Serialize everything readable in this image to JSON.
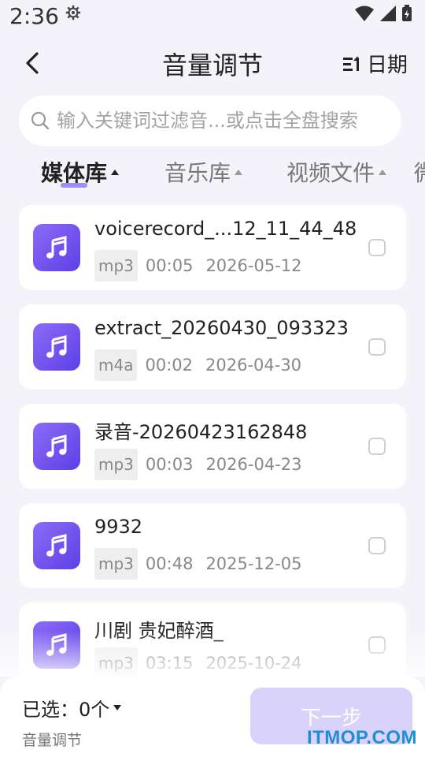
{
  "status_bar": {
    "time": "2:36",
    "icons": [
      "gear-icon",
      "wifi-icon",
      "signal-icon",
      "battery-charging-icon"
    ]
  },
  "header": {
    "title": "音量调节",
    "back_icon": "chevron-left-icon",
    "sort_icon": "sort-icon",
    "sort_label": "日期"
  },
  "search": {
    "placeholder": "输入关键词过滤音...或点击全盘搜索",
    "icon": "search-icon"
  },
  "tabs": [
    {
      "label": "媒体库",
      "active": true
    },
    {
      "label": "音乐库",
      "active": false
    },
    {
      "label": "视频文件",
      "active": false
    },
    {
      "label": "微",
      "active": false
    }
  ],
  "accent_color": "#7E63F3",
  "files": [
    {
      "name": "voicerecord_...12_11_44_48",
      "ext": "mp3",
      "duration": "00:05",
      "date": "2026-05-12",
      "icon": "music-note-icon"
    },
    {
      "name": "extract_20260430_093323",
      "ext": "m4a",
      "duration": "00:02",
      "date": "2026-04-30",
      "icon": "music-note-icon"
    },
    {
      "name": "录音-20260423162848",
      "ext": "mp3",
      "duration": "00:03",
      "date": "2026-04-23",
      "icon": "music-note-icon"
    },
    {
      "name": "9932",
      "ext": "mp3",
      "duration": "00:48",
      "date": "2025-12-05",
      "icon": "music-note-icon"
    },
    {
      "name": "川剧 贵妃醉酒_",
      "ext": "mp3",
      "duration": "03:15",
      "date": "2025-10-24",
      "icon": "music-note-icon"
    }
  ],
  "bottom_bar": {
    "selected_label": "已选：0个",
    "subtitle": "音量调节",
    "next_label": "下一步",
    "watermark": "ITMOP.COM"
  }
}
